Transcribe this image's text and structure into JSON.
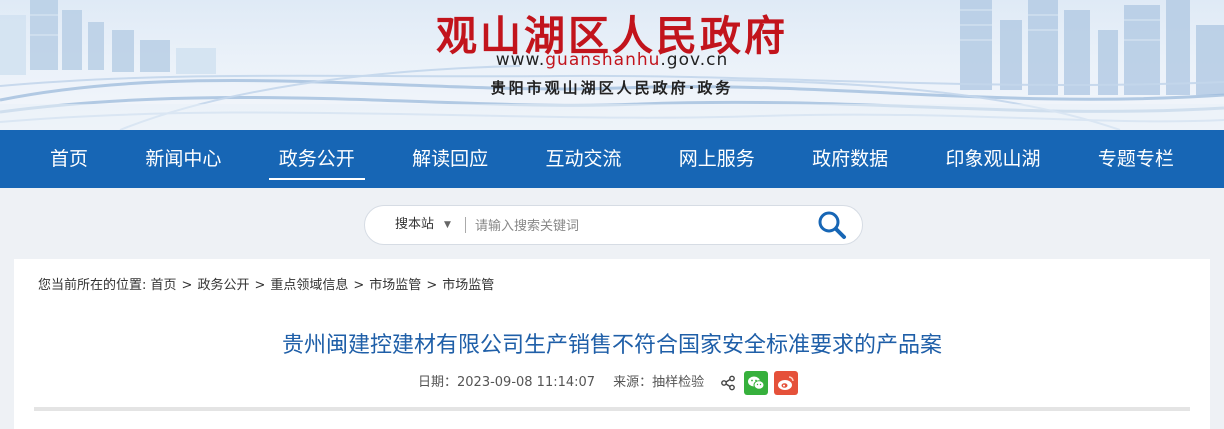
{
  "site": {
    "title": "观山湖区人民政府",
    "url_prefix": "www.",
    "url_highlight": "guanshanhu",
    "url_suffix": ".gov.cn",
    "subtitle": "贵阳市观山湖区人民政府·政务"
  },
  "nav": {
    "items": [
      {
        "label": "首页"
      },
      {
        "label": "新闻中心"
      },
      {
        "label": "政务公开",
        "active": true
      },
      {
        "label": "解读回应"
      },
      {
        "label": "互动交流"
      },
      {
        "label": "网上服务"
      },
      {
        "label": "政府数据"
      },
      {
        "label": "印象观山湖"
      },
      {
        "label": "专题专栏"
      }
    ],
    "color": "#1766b5"
  },
  "search": {
    "scope_label": "搜本站",
    "placeholder": "请输入搜索关键词",
    "button_icon": "search-icon"
  },
  "breadcrumb": {
    "prefix": "您当前所在的位置:",
    "items": [
      "首页",
      "政务公开",
      "重点领域信息",
      "市场监管",
      "市场监管"
    ],
    "separator": ">"
  },
  "article": {
    "title": "贵州闽建控建材有限公司生产销售不符合国家安全标准要求的产品案",
    "date": "日期：2023-09-08 11:14:07",
    "source": "来源：抽样检验",
    "share_icons": [
      "share-icon",
      "wechat-icon",
      "weibo-icon"
    ]
  },
  "colors": {
    "title_red": "#c2141c",
    "article_title_blue": "#1f5fa8",
    "wechat_green": "#36b03c",
    "weibo_red": "#e5513a"
  }
}
